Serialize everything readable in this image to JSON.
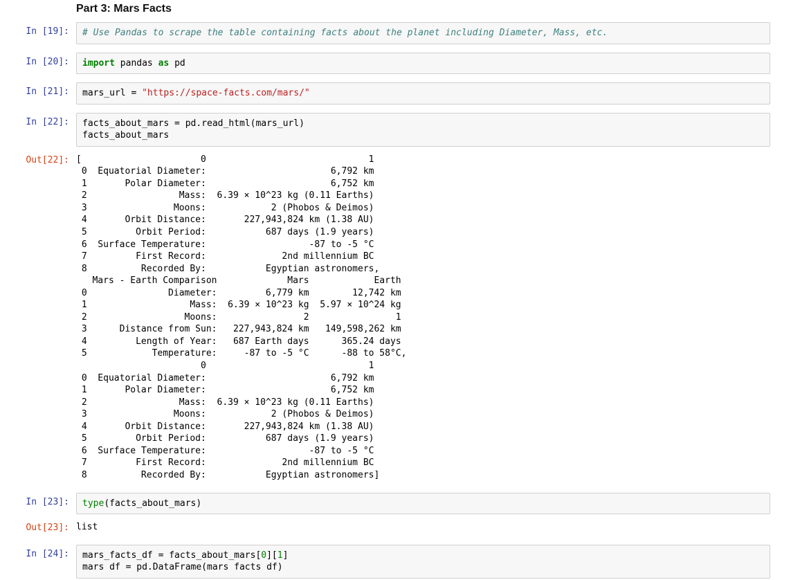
{
  "heading": "Part 3: Mars Facts",
  "cells": {
    "c19": {
      "prompt_in": "In [19]:",
      "code": {
        "comment": "# Use Pandas to scrape the table containing facts about the planet including Diameter, Mass, etc."
      }
    },
    "c20": {
      "prompt_in": "In [20]:",
      "code": {
        "kw_import": "import",
        "mod": " pandas ",
        "kw_as": "as",
        "alias": " pd"
      }
    },
    "c21": {
      "prompt_in": "In [21]:",
      "code": {
        "lhs": "mars_url = ",
        "str": "\"https://space-facts.com/mars/\""
      }
    },
    "c22": {
      "prompt_in": "In [22]:",
      "prompt_out": "Out[22]:",
      "code_line1": "facts_about_mars = pd.read_html(mars_url)",
      "code_line2": "facts_about_mars",
      "output": "[                      0                              1\n 0  Equatorial Diameter:                       6,792 km\n 1       Polar Diameter:                       6,752 km\n 2                 Mass:  6.39 × 10^23 kg (0.11 Earths)\n 3                Moons:            2 (Phobos & Deimos)\n 4       Orbit Distance:       227,943,824 km (1.38 AU)\n 5         Orbit Period:           687 days (1.9 years)\n 6  Surface Temperature:                   -87 to -5 °C\n 7         First Record:              2nd millennium BC\n 8          Recorded By:           Egyptian astronomers,\n   Mars - Earth Comparison             Mars            Earth\n 0               Diameter:         6,779 km        12,742 km\n 1                   Mass:  6.39 × 10^23 kg  5.97 × 10^24 kg\n 2                  Moons:                2                1\n 3      Distance from Sun:   227,943,824 km   149,598,262 km\n 4         Length of Year:   687 Earth days      365.24 days\n 5            Temperature:     -87 to -5 °C      -88 to 58°C,\n                       0                              1\n 0  Equatorial Diameter:                       6,792 km\n 1       Polar Diameter:                       6,752 km\n 2                 Mass:  6.39 × 10^23 kg (0.11 Earths)\n 3                Moons:            2 (Phobos & Deimos)\n 4       Orbit Distance:       227,943,824 km (1.38 AU)\n 5         Orbit Period:           687 days (1.9 years)\n 6  Surface Temperature:                   -87 to -5 °C\n 7         First Record:              2nd millennium BC\n 8          Recorded By:           Egyptian astronomers]"
    },
    "c23": {
      "prompt_in": "In [23]:",
      "prompt_out": "Out[23]:",
      "code": {
        "builtin": "type",
        "rest": "(facts_about_mars)"
      },
      "output": "list"
    },
    "c24": {
      "prompt_in": "In [24]:",
      "code": {
        "l1_a": "mars_facts_df = facts_about_mars[",
        "l1_n1": "0",
        "l1_b": "][",
        "l1_n2": "1",
        "l1_c": "]",
        "l2": "mars df = pd.DataFrame(mars facts df)"
      }
    }
  }
}
